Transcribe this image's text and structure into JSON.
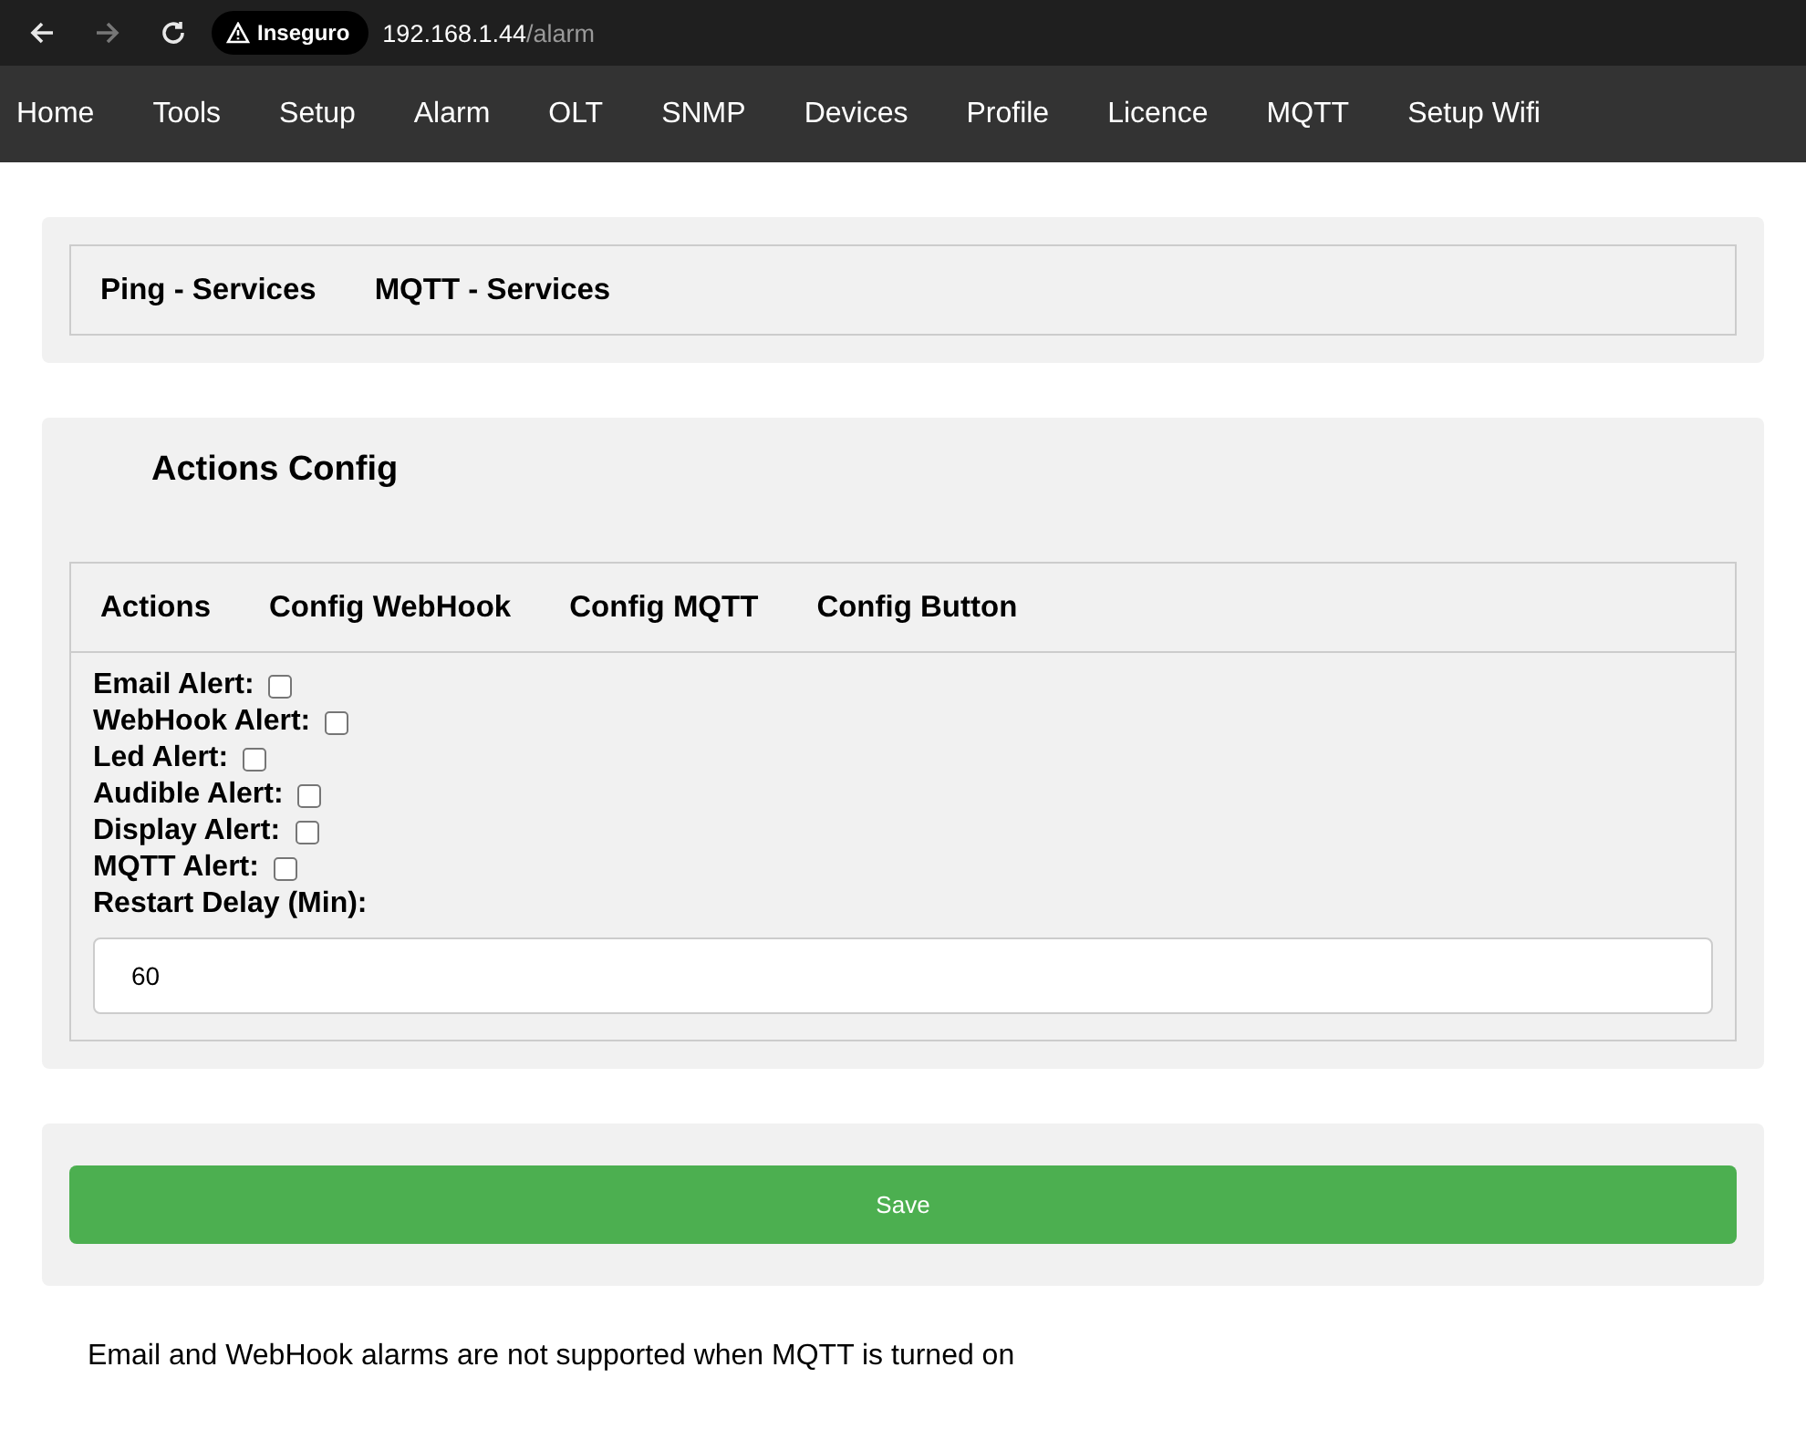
{
  "browser": {
    "security_label": "Inseguro",
    "url_host": "192.168.1.44",
    "url_path": "/alarm"
  },
  "nav": [
    "Home",
    "Tools",
    "Setup",
    "Alarm",
    "OLT",
    "SNMP",
    "Devices",
    "Profile",
    "Licence",
    "MQTT",
    "Setup Wifi"
  ],
  "service_tabs": [
    "Ping - Services",
    "MQTT - Services"
  ],
  "actions": {
    "title": "Actions Config",
    "tabs": [
      "Actions",
      "Config WebHook",
      "Config MQTT",
      "Config Button"
    ],
    "alerts": [
      {
        "label": "Email Alert:",
        "checked": false
      },
      {
        "label": "WebHook Alert:",
        "checked": false
      },
      {
        "label": "Led Alert:",
        "checked": false
      },
      {
        "label": "Audible Alert:",
        "checked": false
      },
      {
        "label": "Display Alert:",
        "checked": false
      },
      {
        "label": "MQTT Alert:",
        "checked": false
      }
    ],
    "delay_label": "Restart Delay (Min):",
    "delay_value": "60"
  },
  "save_button": "Save",
  "note": "Email and WebHook alarms are not supported when MQTT is turned on"
}
